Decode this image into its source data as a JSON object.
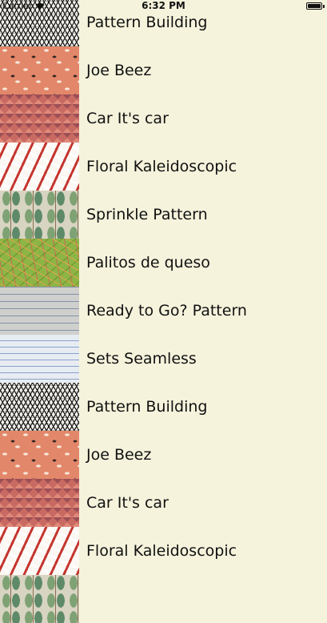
{
  "status_bar": {
    "carrier": "Carrier",
    "time": "6:32 PM"
  },
  "patterns": [
    {
      "title": "Pattern Building",
      "thumbnail": "pattern-building"
    },
    {
      "title": "Joe Beez",
      "thumbnail": "joe-beez"
    },
    {
      "title": "Car It's car",
      "thumbnail": "car"
    },
    {
      "title": "Floral Kaleidoscopic",
      "thumbnail": "floral"
    },
    {
      "title": "Sprinkle Pattern",
      "thumbnail": "sprinkle"
    },
    {
      "title": "Palitos de queso",
      "thumbnail": "palitos"
    },
    {
      "title": "Ready to Go? Pattern",
      "thumbnail": "ready"
    },
    {
      "title": "Sets Seamless",
      "thumbnail": "sets"
    },
    {
      "title": "Pattern Building",
      "thumbnail": "pattern-building"
    },
    {
      "title": "Joe Beez",
      "thumbnail": "joe-beez"
    },
    {
      "title": "Car It's car",
      "thumbnail": "car"
    },
    {
      "title": "Floral Kaleidoscopic",
      "thumbnail": "floral"
    },
    {
      "title": "",
      "thumbnail": "sprinkle"
    }
  ],
  "colors": {
    "background": "#f5f3dc",
    "text": "#111111"
  }
}
